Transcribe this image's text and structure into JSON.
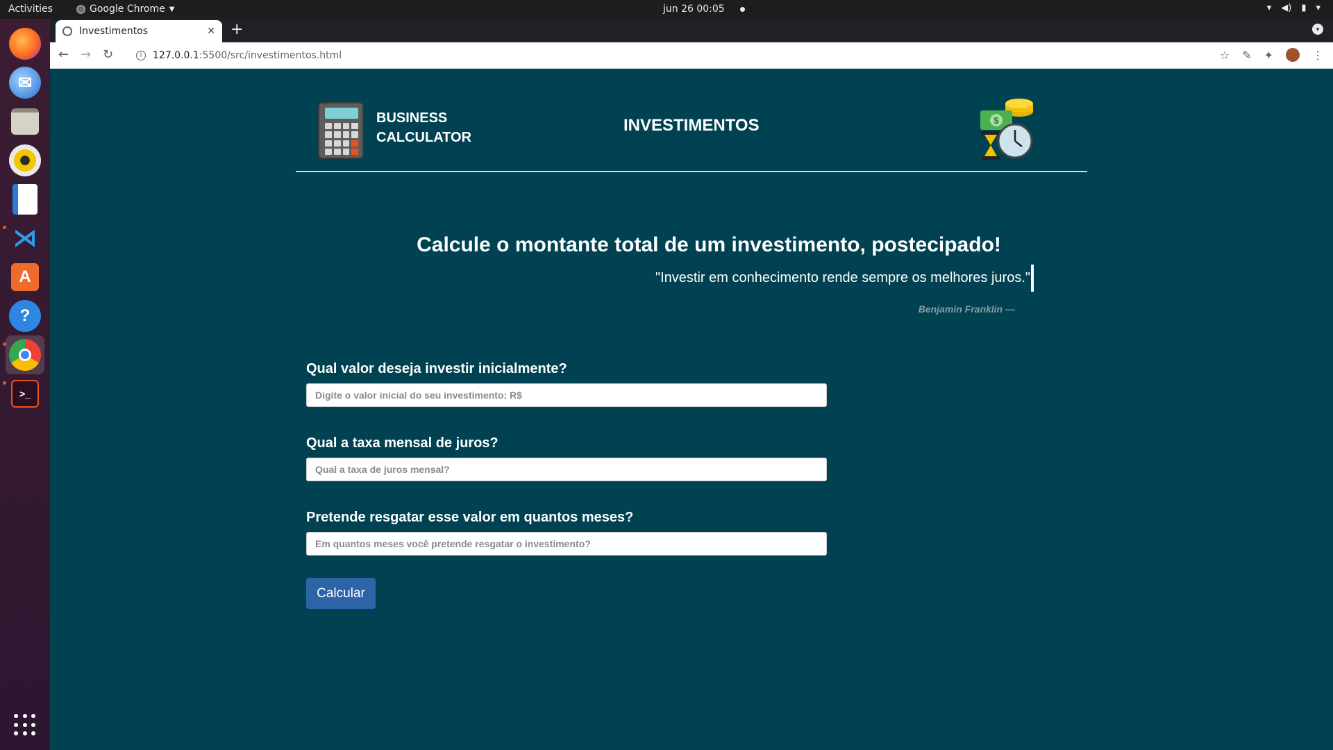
{
  "system": {
    "activities": "Activities",
    "app_name": "Google Chrome",
    "clock": "jun 26  00:05"
  },
  "browser": {
    "tab_title": "Investimentos",
    "url_host": "127.0.0.1",
    "url_path": ":5500/src/investimentos.html"
  },
  "header": {
    "brand_line1": "BUSINESS",
    "brand_line2": "CALCULATOR",
    "page_title": "INVESTIMENTOS"
  },
  "hero": {
    "headline": "Calcule o montante total de um investimento, postecipado!",
    "quote": "\"Investir em conhecimento rende sempre os melhores juros.\"",
    "author": "Benjamin Franklin —"
  },
  "form": {
    "fields": [
      {
        "label": "Qual valor deseja investir inicialmente?",
        "placeholder": "Digite o valor inicial do seu investimento: R$"
      },
      {
        "label": "Qual a taxa mensal de juros?",
        "placeholder": "Qual a taxa de juros mensal?"
      },
      {
        "label": "Pretende resgatar esse valor em quantos meses?",
        "placeholder": "Em quantos meses você pretende resgatar o investimento?"
      }
    ],
    "submit_label": "Calcular"
  },
  "dock": {
    "apps": [
      "firefox-icon",
      "thunderbird-icon",
      "files-icon",
      "rhythmbox-icon",
      "writer-icon",
      "vscode-icon",
      "software-icon",
      "help-icon",
      "chrome-icon",
      "terminal-icon"
    ]
  },
  "colors": {
    "page_bg": "#004152",
    "button_bg": "#2d64a8",
    "author_text": "#8a9ca4"
  }
}
